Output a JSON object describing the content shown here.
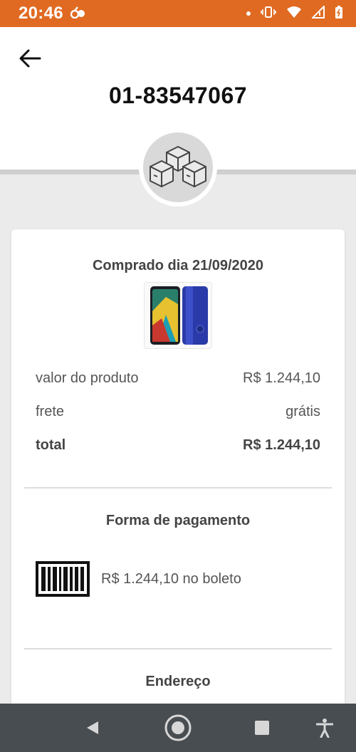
{
  "status_bar": {
    "time": "20:46"
  },
  "header": {
    "order_number": "01-83547067"
  },
  "order": {
    "purchase_date": "Comprado dia 21/09/2020",
    "summary": {
      "product_value_label": "valor do produto",
      "product_value": "R$ 1.244,10",
      "shipping_label": "frete",
      "shipping_value": "grátis",
      "total_label": "total",
      "total_value": "R$ 1.244,10"
    },
    "payment": {
      "title": "Forma de pagamento",
      "text": "R$ 1.244,10 no boleto",
      "icon": "barcode-icon"
    },
    "address": {
      "title": "Endereço"
    }
  },
  "colors": {
    "status_bar": "#e06a22",
    "nav_bar": "#474d51",
    "background": "#ebebeb"
  }
}
